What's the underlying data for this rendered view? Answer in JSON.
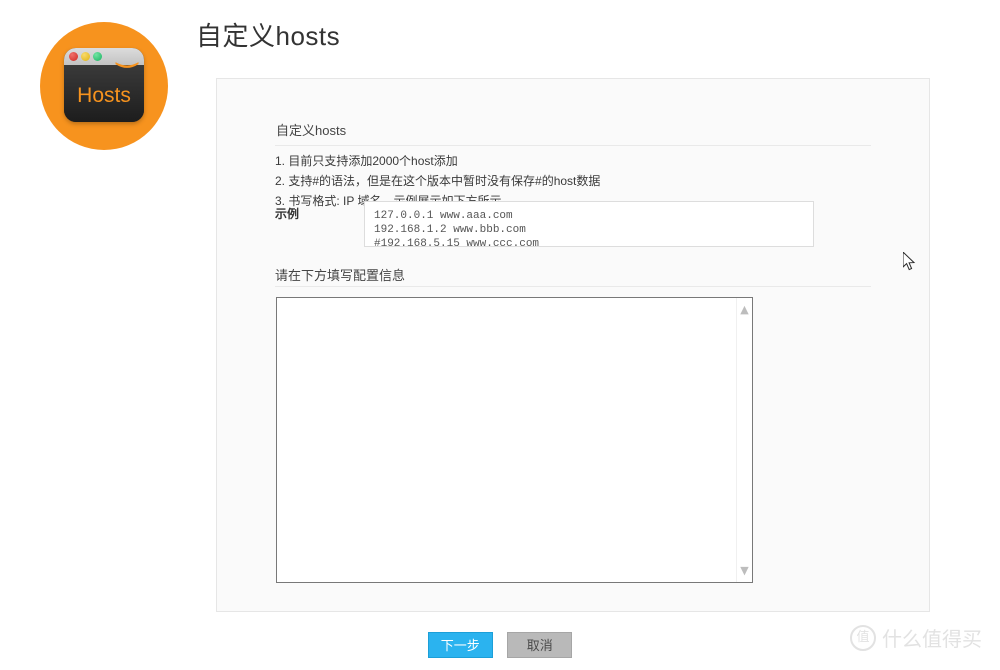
{
  "app": {
    "icon": {
      "label": "Hosts",
      "smiley": ")",
      "background_color": "#F7931E",
      "dots": [
        "red-dot",
        "yellow-dot",
        "green-dot"
      ]
    },
    "page_title": "自定义hosts"
  },
  "panel": {
    "section_heading": "自定义hosts",
    "notes": [
      "1. 目前只支持添加2000个host添加",
      "2. 支持#的语法，但是在这个版本中暂时没有保存#的host数据",
      "3. 书写格式: IP 域名，示例展示如下方所示"
    ],
    "example": {
      "label": "示例",
      "lines": [
        "127.0.0.1 www.aaa.com",
        "192.168.1.2 www.bbb.com",
        "#192.168.5.15 www.ccc.com"
      ]
    },
    "fill_label": "请在下方填写配置信息",
    "textarea": {
      "value": "",
      "placeholder": "",
      "scroll_up_icon": "chevron-up-icon",
      "scroll_down_icon": "chevron-down-icon"
    }
  },
  "footer": {
    "next_label": "下一步",
    "cancel_label": "取消",
    "next_color": "#2bb3ef",
    "cancel_color": "#b9b9b9"
  },
  "watermark": {
    "badge": "值",
    "text": "什么值得买"
  }
}
